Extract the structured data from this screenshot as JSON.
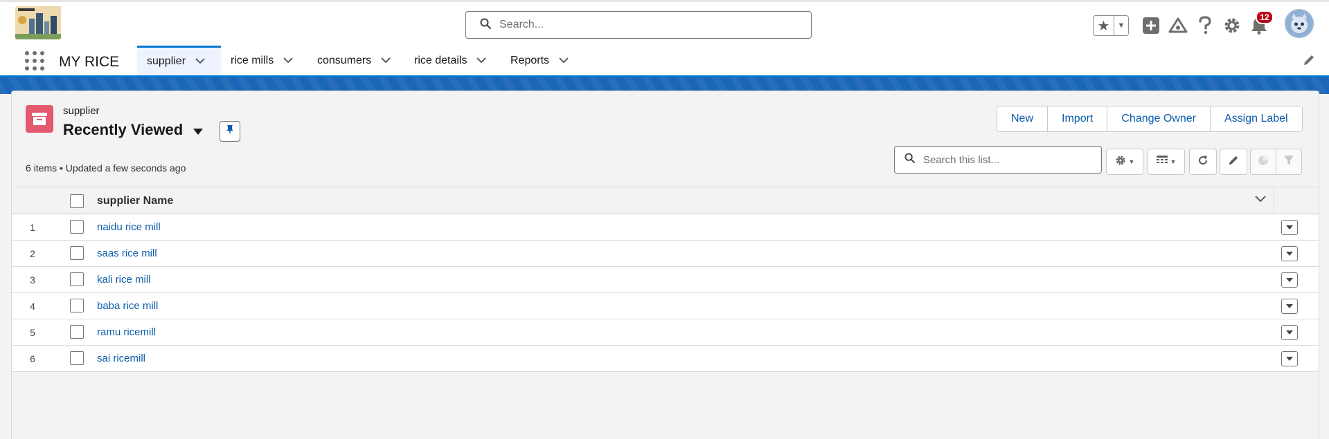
{
  "header": {
    "search_placeholder": "Search...",
    "notification_count": "12"
  },
  "nav": {
    "app_name": "MY RICE",
    "tabs": [
      {
        "label": "supplier",
        "active": true
      },
      {
        "label": "rice mills",
        "active": false
      },
      {
        "label": "consumers",
        "active": false
      },
      {
        "label": "rice details",
        "active": false
      },
      {
        "label": "Reports",
        "active": false
      }
    ]
  },
  "list_view": {
    "object_label": "supplier",
    "view_name": "Recently Viewed",
    "meta": "6 items • Updated a few seconds ago",
    "buttons": [
      "New",
      "Import",
      "Change Owner",
      "Assign Label"
    ],
    "search_placeholder": "Search this list...",
    "column_header": "supplier Name",
    "rows": [
      {
        "num": "1",
        "name": "naidu rice mill"
      },
      {
        "num": "2",
        "name": "saas rice mill"
      },
      {
        "num": "3",
        "name": "kali rice mill"
      },
      {
        "num": "4",
        "name": "baba rice mill"
      },
      {
        "num": "5",
        "name": "ramu ricemill"
      },
      {
        "num": "6",
        "name": "sai ricemill"
      }
    ]
  },
  "colors": {
    "brand_blue": "#0176d3",
    "link": "#0b5cab",
    "object_icon": "#e3596e",
    "badge": "#ba0517"
  }
}
